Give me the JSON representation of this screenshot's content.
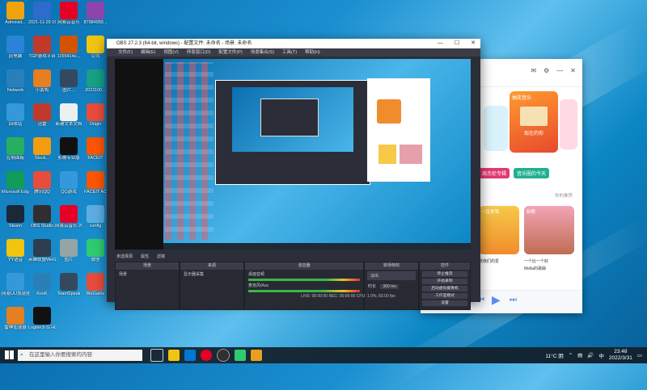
{
  "desktop_icons": [
    {
      "label": "Administ...",
      "color": "#f0a30a"
    },
    {
      "label": "2021-11-29 16:11:56...",
      "color": "#2d6ccc"
    },
    {
      "label": "网易云音乐",
      "color": "#e60026"
    },
    {
      "label": "87984955...",
      "color": "#8e44ad"
    },
    {
      "label": "此电脑",
      "color": "#2a83d6"
    },
    {
      "label": "TGP游戏平台",
      "color": "#c0392b"
    },
    {
      "label": "1155414e...",
      "color": "#d35400"
    },
    {
      "label": "公司",
      "color": "#f1c40f"
    },
    {
      "label": "Network",
      "color": "#2980b9"
    },
    {
      "label": "小黄鸭",
      "color": "#e67e22"
    },
    {
      "label": "图片...",
      "color": "#34495e"
    },
    {
      "label": "2021100...",
      "color": "#16a085"
    },
    {
      "label": "回收站",
      "color": "#3498db"
    },
    {
      "label": "迅雷",
      "color": "#c0392b"
    },
    {
      "label": "新建文本文档",
      "color": "#ecf0f1"
    },
    {
      "label": "Origin",
      "color": "#e74c3c"
    },
    {
      "label": "控制面板",
      "color": "#27ae60"
    },
    {
      "label": "Stock...",
      "color": "#f39c12"
    },
    {
      "label": "剪映专业版",
      "color": "#111111"
    },
    {
      "label": "FACEIT",
      "color": "#ff5500"
    },
    {
      "label": "Microsoft Edge",
      "color": "#0f9d58"
    },
    {
      "label": "腾讯QQ",
      "color": "#e74c3c"
    },
    {
      "label": "QQ游戏",
      "color": "#3498db"
    },
    {
      "label": "FACEIT AC",
      "color": "#ff5500"
    },
    {
      "label": "Steam",
      "color": "#1b2838"
    },
    {
      "label": "OBS Studio",
      "color": "#302e31"
    },
    {
      "label": "网易云音乐 2022...",
      "color": "#e60026"
    },
    {
      "label": "config",
      "color": "#5dade2"
    },
    {
      "label": "YY语音",
      "color": "#f1c40f"
    },
    {
      "label": "英雄联盟WeGame",
      "color": "#2c3e50"
    },
    {
      "label": "图片",
      "color": "#95a5a6"
    },
    {
      "label": "微信",
      "color": "#2ecc71"
    },
    {
      "label": "网易UU加速器",
      "color": "#3498db"
    },
    {
      "label": "KooK",
      "color": "#2980b9"
    },
    {
      "label": "TeamSpeak",
      "color": "#34495e"
    },
    {
      "label": "WeGame",
      "color": "#e74c3c"
    },
    {
      "label": "雷神加速器",
      "color": "#e67e22"
    },
    {
      "label": "Logitech G HUB",
      "color": "#111111"
    }
  ],
  "obs": {
    "title": "OBS 27.2.3 (64-bit, windows) - 配置文件: 未命名 - 场景: 未命名",
    "menu": [
      "文件(F)",
      "编辑(E)",
      "视图(V)",
      "停靠窗口(D)",
      "配置文件(P)",
      "场景集合(S)",
      "工具(T)",
      "帮助(H)"
    ],
    "no_source_selected": "未选择源",
    "properties": "属性",
    "filters": "滤镜",
    "docks": {
      "scenes": {
        "title": "场景",
        "items": [
          "场景"
        ]
      },
      "sources": {
        "title": "来源",
        "items": [
          "显示器采集"
        ]
      },
      "mixer": {
        "title": "混音器",
        "tracks": [
          "桌面音频",
          "麦克风/Aux"
        ]
      },
      "transitions": {
        "title": "转场特效",
        "type": "淡出",
        "duration_label": "时长",
        "duration": "300 ms"
      },
      "controls": {
        "title": "控件",
        "buttons": [
          "停止推流",
          "开始录制",
          "启动虚拟摄像机",
          "工作室模式",
          "设置",
          "退出"
        ]
      }
    },
    "status": "LIVE: 00:00:00   REC: 00:00:00   CPU: 1.0%, 60.00 fps"
  },
  "music": {
    "banner": "抽奖音乐",
    "sub": "现在的你",
    "tag1": "周杰伦专辑",
    "tag2": "音乐圈的今天",
    "sub2": "你的推荐",
    "song1": "一直是我",
    "song2": "新歌",
    "caption1": "致我们的爱",
    "caption2": "一个比一个好",
    "caption3": "Mella的歌曲"
  },
  "taskbar": {
    "search_placeholder": "在这里输入你要搜索的内容",
    "weather": "11°C 阴",
    "time": "23:48",
    "date": "2022/3/31",
    "ime": "中",
    "accent": "#0078d4"
  }
}
